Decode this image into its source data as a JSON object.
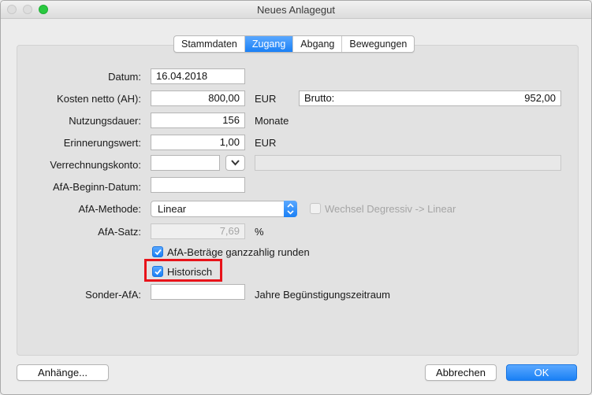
{
  "window": {
    "title": "Neues Anlagegut"
  },
  "tabs": [
    {
      "label": "Stammdaten",
      "active": false
    },
    {
      "label": "Zugang",
      "active": true
    },
    {
      "label": "Abgang",
      "active": false
    },
    {
      "label": "Bewegungen",
      "active": false
    }
  ],
  "form": {
    "datum": {
      "label": "Datum:",
      "value": "16.04.2018"
    },
    "kosten": {
      "label": "Kosten netto (AH):",
      "value": "800,00",
      "unit": "EUR",
      "brutto_label": "Brutto:",
      "brutto_value": "952,00"
    },
    "nutzungsdauer": {
      "label": "Nutzungsdauer:",
      "value": "156",
      "unit": "Monate"
    },
    "erinnerungswert": {
      "label": "Erinnerungswert:",
      "value": "1,00",
      "unit": "EUR"
    },
    "verrechnungskonto": {
      "label": "Verrechnungskonto:",
      "value": "",
      "description": ""
    },
    "afa_beginn": {
      "label": "AfA-Beginn-Datum:",
      "value": ""
    },
    "afa_methode": {
      "label": "AfA-Methode:",
      "selected": "Linear",
      "wechsel_label": "Wechsel Degressiv -> Linear",
      "wechsel_checked": false
    },
    "afa_satz": {
      "label": "AfA-Satz:",
      "value": "7,69",
      "unit": "%"
    },
    "runden": {
      "label": "AfA-Beträge ganzzahlig runden",
      "checked": true
    },
    "historisch": {
      "label": "Historisch",
      "checked": true
    },
    "sonder_afa": {
      "label": "Sonder-AfA:",
      "value": "",
      "unit": "Jahre Begünstigungszeitraum"
    }
  },
  "buttons": {
    "anhaenge": "Anhänge...",
    "abbrechen": "Abbrechen",
    "ok": "OK"
  },
  "colors": {
    "accent": "#1a80f5",
    "highlight": "#e8131a"
  },
  "icons": {
    "popup": "chevron-updown-icon",
    "combo": "chevron-down-icon",
    "check": "checkmark-icon"
  }
}
